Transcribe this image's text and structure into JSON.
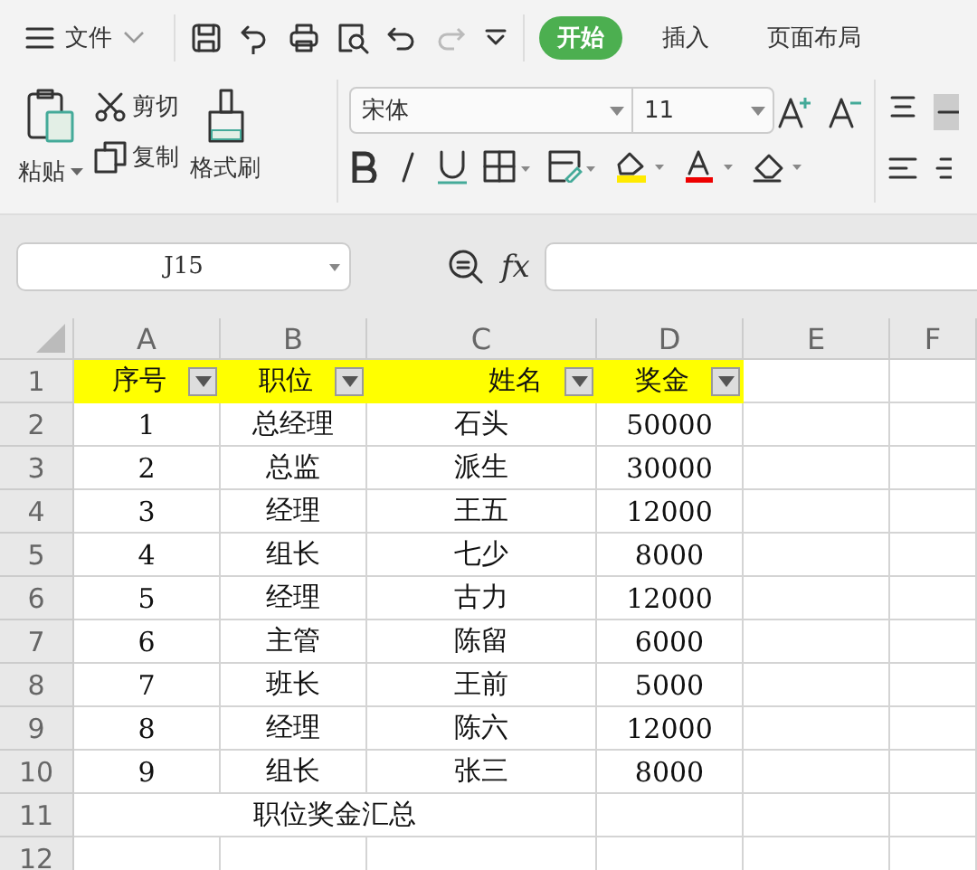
{
  "menu": {
    "file_label": "文件",
    "tabs": [
      {
        "label": "开始",
        "selected": true
      },
      {
        "label": "插入",
        "selected": false
      },
      {
        "label": "页面布局",
        "selected": false
      }
    ]
  },
  "ribbon": {
    "paste": "粘贴",
    "cut": "剪切",
    "copy": "复制",
    "format_painter": "格式刷",
    "font": "宋体",
    "font_size": "11"
  },
  "formula_bar": {
    "name_box": "J15",
    "fx": "fx"
  },
  "sheet": {
    "columns": [
      "A",
      "B",
      "C",
      "D",
      "E",
      "F"
    ],
    "rows": [
      {
        "number": "1",
        "kind": "header",
        "cells": [
          "序号",
          "职位",
          "姓名",
          "奖金"
        ]
      },
      {
        "number": "2",
        "kind": "data",
        "cells": [
          "1",
          "总经理",
          "石头",
          "50000"
        ]
      },
      {
        "number": "3",
        "kind": "data",
        "cells": [
          "2",
          "总监",
          "派生",
          "30000"
        ]
      },
      {
        "number": "4",
        "kind": "data",
        "cells": [
          "3",
          "经理",
          "王五",
          "12000"
        ]
      },
      {
        "number": "5",
        "kind": "data",
        "cells": [
          "4",
          "组长",
          "七少",
          "8000"
        ]
      },
      {
        "number": "6",
        "kind": "data",
        "cells": [
          "5",
          "经理",
          "古力",
          "12000"
        ]
      },
      {
        "number": "7",
        "kind": "data",
        "cells": [
          "6",
          "主管",
          "陈留",
          "6000"
        ]
      },
      {
        "number": "8",
        "kind": "data",
        "cells": [
          "7",
          "班长",
          "王前",
          "5000"
        ]
      },
      {
        "number": "9",
        "kind": "data",
        "cells": [
          "8",
          "经理",
          "陈六",
          "12000"
        ]
      },
      {
        "number": "10",
        "kind": "data",
        "cells": [
          "9",
          "组长",
          "张三",
          "8000"
        ]
      },
      {
        "number": "11",
        "kind": "merged",
        "cells": [
          {
            "text": "职位奖金汇总",
            "colspan": 3
          }
        ]
      },
      {
        "number": "12",
        "kind": "data",
        "cells": []
      }
    ]
  }
}
